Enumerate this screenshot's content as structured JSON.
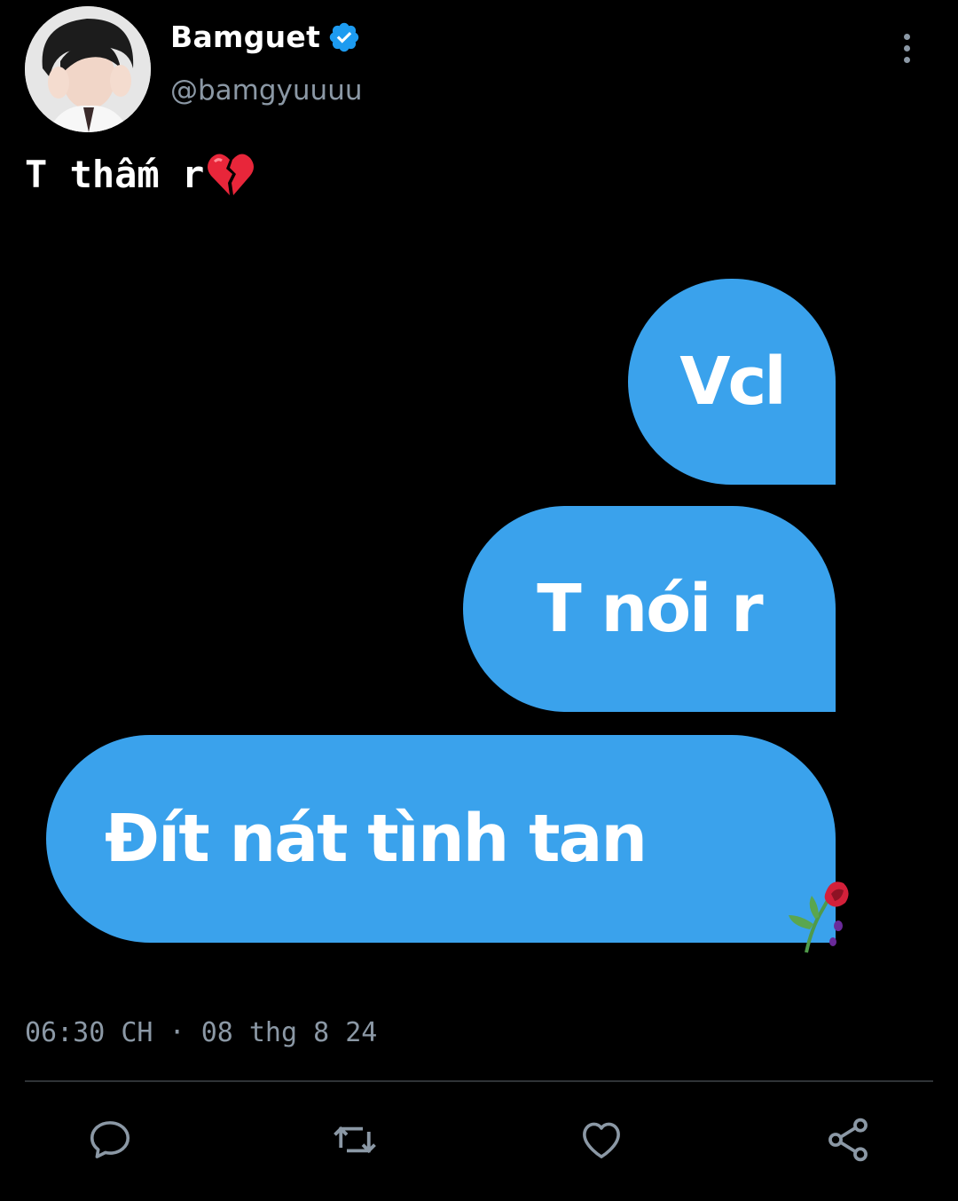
{
  "author": {
    "display_name": "Bamguet",
    "handle": "@bamgyuuuu",
    "verified": true,
    "avatar_icon": "profile-photo"
  },
  "tweet": {
    "text": "T thấm r",
    "emoji": "broken-heart-icon"
  },
  "media": {
    "bubbles": [
      {
        "text": "Vcl"
      },
      {
        "text": "T nói r"
      },
      {
        "text": "Đít nát tình tan",
        "emoji": "wilted-rose-icon"
      }
    ],
    "bubble_color": "#3aa2ec"
  },
  "meta": {
    "time": "06:30 CH",
    "separator": "·",
    "date": "08 thg 8 24"
  },
  "actions": [
    {
      "name": "reply",
      "icon": "comment-icon"
    },
    {
      "name": "retweet",
      "icon": "retweet-icon"
    },
    {
      "name": "like",
      "icon": "heart-icon"
    },
    {
      "name": "share",
      "icon": "share-icon"
    }
  ],
  "colors": {
    "background": "#000000",
    "secondary_text": "#8b98a5",
    "verified": "#1d9bf0",
    "divider": "#2f3336"
  }
}
